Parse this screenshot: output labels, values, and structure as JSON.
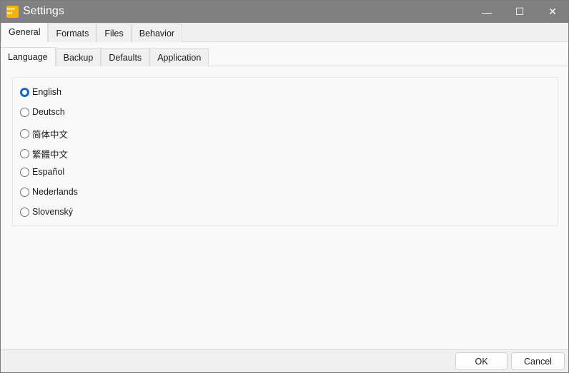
{
  "window": {
    "title": "Settings",
    "logo_text": "inter act",
    "minimize": "—",
    "maximize": "☐",
    "close": "✕"
  },
  "tabs_top": [
    {
      "label": "General",
      "active": true
    },
    {
      "label": "Formats"
    },
    {
      "label": "Files"
    },
    {
      "label": "Behavior"
    }
  ],
  "tabs_sub": [
    {
      "label": "Language",
      "active": true
    },
    {
      "label": "Backup"
    },
    {
      "label": "Defaults"
    },
    {
      "label": "Application"
    }
  ],
  "languages": [
    {
      "label": "English",
      "selected": true
    },
    {
      "label": "Deutsch"
    },
    {
      "label": "简体中文"
    },
    {
      "label": "繁體中文"
    },
    {
      "label": "Español"
    },
    {
      "label": "Nederlands"
    },
    {
      "label": "Slovenský"
    }
  ],
  "footer": {
    "ok": "OK",
    "cancel": "Cancel"
  },
  "colors": {
    "accent": "#1a66c4",
    "titlebar": "#808080",
    "logo": "#f5b400"
  }
}
